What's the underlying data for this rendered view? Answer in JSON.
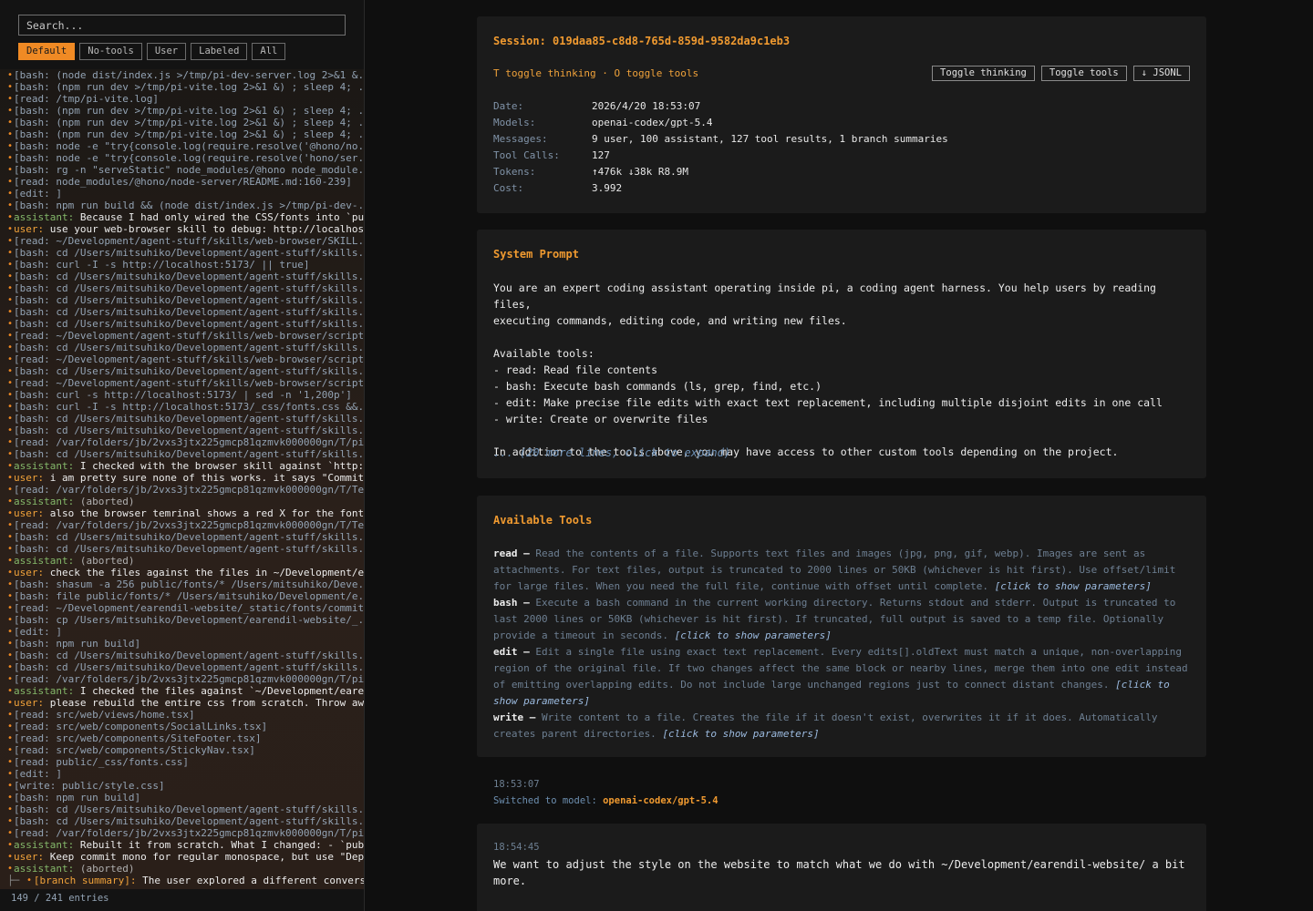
{
  "sidebar": {
    "search_placeholder": "Search...",
    "filters": [
      {
        "label": "Default",
        "active": true
      },
      {
        "label": "No-tools",
        "active": false
      },
      {
        "label": "User",
        "active": false
      },
      {
        "label": "Labeled",
        "active": false
      },
      {
        "label": "All",
        "active": false
      }
    ],
    "entries": [
      {
        "kind": "tool",
        "text": "[bash: (node dist/index.js >/tmp/pi-dev-server.log 2>&1 &."
      },
      {
        "kind": "tool",
        "text": "[bash: (npm run dev >/tmp/pi-vite.log 2>&1 &) ; sleep 4; ."
      },
      {
        "kind": "tool",
        "text": "[read: /tmp/pi-vite.log]"
      },
      {
        "kind": "tool",
        "text": "[bash: (npm run dev >/tmp/pi-vite.log 2>&1 &) ; sleep 4; ."
      },
      {
        "kind": "tool",
        "text": "[bash: (npm run dev >/tmp/pi-vite.log 2>&1 &) ; sleep 4; ."
      },
      {
        "kind": "tool",
        "text": "[bash: (npm run dev >/tmp/pi-vite.log 2>&1 &) ; sleep 4; ."
      },
      {
        "kind": "tool",
        "text": "[bash: node -e \"try{console.log(require.resolve('@hono/no."
      },
      {
        "kind": "tool",
        "text": "[bash: node -e \"try{console.log(require.resolve('hono/ser."
      },
      {
        "kind": "tool",
        "text": "[bash: rg -n \"serveStatic\" node_modules/@hono node_module."
      },
      {
        "kind": "tool",
        "text": "[read: node_modules/@hono/node-server/README.md:160-239]"
      },
      {
        "kind": "tool",
        "text": "[edit: ]"
      },
      {
        "kind": "tool",
        "text": "[bash: npm run build && (node dist/index.js >/tmp/pi-dev-."
      },
      {
        "kind": "asst",
        "role": "assistant:",
        "text": "Because I had only wired the CSS/fonts into `pu"
      },
      {
        "kind": "user",
        "role": "user:",
        "text": "use your web-browser skill to debug: http://localhos"
      },
      {
        "kind": "tool",
        "text": "[read: ~/Development/agent-stuff/skills/web-browser/SKILL."
      },
      {
        "kind": "tool",
        "text": "[bash: cd /Users/mitsuhiko/Development/agent-stuff/skills."
      },
      {
        "kind": "tool",
        "text": "[bash: curl -I -s http://localhost:5173/ || true]"
      },
      {
        "kind": "tool",
        "text": "[bash: cd /Users/mitsuhiko/Development/agent-stuff/skills."
      },
      {
        "kind": "tool",
        "text": "[bash: cd /Users/mitsuhiko/Development/agent-stuff/skills."
      },
      {
        "kind": "tool",
        "text": "[bash: cd /Users/mitsuhiko/Development/agent-stuff/skills."
      },
      {
        "kind": "tool",
        "text": "[bash: cd /Users/mitsuhiko/Development/agent-stuff/skills."
      },
      {
        "kind": "tool",
        "text": "[bash: cd /Users/mitsuhiko/Development/agent-stuff/skills."
      },
      {
        "kind": "tool",
        "text": "[read: ~/Development/agent-stuff/skills/web-browser/script"
      },
      {
        "kind": "tool",
        "text": "[bash: cd /Users/mitsuhiko/Development/agent-stuff/skills."
      },
      {
        "kind": "tool",
        "text": "[read: ~/Development/agent-stuff/skills/web-browser/script"
      },
      {
        "kind": "tool",
        "text": "[bash: cd /Users/mitsuhiko/Development/agent-stuff/skills."
      },
      {
        "kind": "tool",
        "text": "[read: ~/Development/agent-stuff/skills/web-browser/script"
      },
      {
        "kind": "tool",
        "text": "[bash: curl -s http://localhost:5173/ | sed -n '1,200p']"
      },
      {
        "kind": "tool",
        "text": "[bash: curl -I -s http://localhost:5173/_css/fonts.css &&."
      },
      {
        "kind": "tool",
        "text": "[bash: cd /Users/mitsuhiko/Development/agent-stuff/skills."
      },
      {
        "kind": "tool",
        "text": "[bash: cd /Users/mitsuhiko/Development/agent-stuff/skills."
      },
      {
        "kind": "tool",
        "text": "[read: /var/folders/jb/2vxs3jtx225gmcp81qzmvk000000gn/T/pi"
      },
      {
        "kind": "tool",
        "text": "[bash: cd /Users/mitsuhiko/Development/agent-stuff/skills."
      },
      {
        "kind": "asst",
        "role": "assistant:",
        "text": "I checked with the browser skill against `http:"
      },
      {
        "kind": "user",
        "role": "user:",
        "text": "i am pretty sure none of this works. it says \"Commit"
      },
      {
        "kind": "tool",
        "text": "[read: /var/folders/jb/2vxs3jtx225gmcp81qzmvk000000gn/T/Te"
      },
      {
        "kind": "abort",
        "role": "assistant:",
        "text": "(aborted)"
      },
      {
        "kind": "user",
        "role": "user:",
        "text": "also the browser temrinal shows a red X for the font"
      },
      {
        "kind": "tool",
        "text": "[read: /var/folders/jb/2vxs3jtx225gmcp81qzmvk000000gn/T/Te"
      },
      {
        "kind": "tool",
        "text": "[bash: cd /Users/mitsuhiko/Development/agent-stuff/skills."
      },
      {
        "kind": "tool",
        "text": "[bash: cd /Users/mitsuhiko/Development/agent-stuff/skills."
      },
      {
        "kind": "abort",
        "role": "assistant:",
        "text": "(aborted)"
      },
      {
        "kind": "user",
        "role": "user:",
        "text": "check the files against the files in ~/Development/e"
      },
      {
        "kind": "tool",
        "text": "[bash: shasum -a 256 public/fonts/* /Users/mitsuhiko/Deve."
      },
      {
        "kind": "tool",
        "text": "[bash: file public/fonts/* /Users/mitsuhiko/Development/e."
      },
      {
        "kind": "tool",
        "text": "[read: ~/Development/earendil-website/_static/fonts/commit"
      },
      {
        "kind": "tool",
        "text": "[bash: cp /Users/mitsuhiko/Development/earendil-website/_."
      },
      {
        "kind": "tool",
        "text": "[edit: ]"
      },
      {
        "kind": "tool",
        "text": "[bash: npm run build]"
      },
      {
        "kind": "tool",
        "text": "[bash: cd /Users/mitsuhiko/Development/agent-stuff/skills."
      },
      {
        "kind": "tool",
        "text": "[bash: cd /Users/mitsuhiko/Development/agent-stuff/skills."
      },
      {
        "kind": "tool",
        "text": "[read: /var/folders/jb/2vxs3jtx225gmcp81qzmvk000000gn/T/pi"
      },
      {
        "kind": "asst",
        "role": "assistant:",
        "text": "I checked the files against `~/Development/eare"
      },
      {
        "kind": "user",
        "role": "user:",
        "text": "please rebuild the entire css from scratch. Throw aw"
      },
      {
        "kind": "tool",
        "text": "[read: src/web/views/home.tsx]"
      },
      {
        "kind": "tool",
        "text": "[read: src/web/components/SocialLinks.tsx]"
      },
      {
        "kind": "tool",
        "text": "[read: src/web/components/SiteFooter.tsx]"
      },
      {
        "kind": "tool",
        "text": "[read: src/web/components/StickyNav.tsx]"
      },
      {
        "kind": "tool",
        "text": "[read: public/_css/fonts.css]"
      },
      {
        "kind": "tool",
        "text": "[edit: ]"
      },
      {
        "kind": "tool",
        "text": "[write: public/style.css]"
      },
      {
        "kind": "tool",
        "text": "[bash: npm run build]"
      },
      {
        "kind": "tool",
        "text": "[bash: cd /Users/mitsuhiko/Development/agent-stuff/skills."
      },
      {
        "kind": "tool",
        "text": "[bash: cd /Users/mitsuhiko/Development/agent-stuff/skills."
      },
      {
        "kind": "tool",
        "text": "[read: /var/folders/jb/2vxs3jtx225gmcp81qzmvk000000gn/T/pi"
      },
      {
        "kind": "asst",
        "role": "assistant:",
        "text": "Rebuilt it from scratch. What I changed: - `pub"
      },
      {
        "kind": "user",
        "role": "user:",
        "text": "Keep commit mono for regular monospace, but use \"Dep"
      },
      {
        "kind": "abort",
        "role": "assistant:",
        "text": "(aborted)"
      },
      {
        "kind": "branch",
        "role": "[branch summary]:",
        "text": "The user explored a different convers"
      }
    ],
    "count": "149 / 241 entries"
  },
  "header": {
    "session_title": "Session: 019daa85-c8d8-765d-859d-9582da9c1eb3",
    "toggle_hint": "T toggle thinking · O toggle tools",
    "buttons": [
      "Toggle thinking",
      "Toggle tools",
      "↓ JSONL"
    ],
    "meta": [
      {
        "key": "Date:",
        "value": "2026/4/20 18:53:07"
      },
      {
        "key": "Models:",
        "value": "openai-codex/gpt-5.4"
      },
      {
        "key": "Messages:",
        "value": "9 user, 100 assistant, 127 tool results, 1 branch summaries"
      },
      {
        "key": "Tool Calls:",
        "value": "127"
      },
      {
        "key": "Tokens:",
        "value": "↑476k ↓38k R8.9M"
      },
      {
        "key": "Cost:",
        "value": "3.992"
      }
    ]
  },
  "system_prompt": {
    "title": "System Prompt",
    "body": "You are an expert coding assistant operating inside pi, a coding agent harness. You help users by reading files,\nexecuting commands, editing code, and writing new files.\n\nAvailable tools:\n- read: Read file contents\n- bash: Execute bash commands (ls, grep, find, etc.)\n- edit: Make precise file edits with exact text replacement, including multiple disjoint edits in one call\n- write: Create or overwrite files\n\nIn addition to the tools above, you may have access to other custom tools depending on the project.",
    "more": "... (20 more lines, click to expand)"
  },
  "tools": {
    "title": "Available Tools",
    "items": [
      {
        "name": "read",
        "desc": "Read the contents of a file. Supports text files and images (jpg, png, gif, webp). Images are sent as attachments. For text files, output is truncated to 2000 lines or 50KB (whichever is hit first). Use offset/limit for large files. When you need the full file, continue with offset until complete.",
        "expand": "[click to show parameters]"
      },
      {
        "name": "bash",
        "desc": "Execute a bash command in the current working directory. Returns stdout and stderr. Output is truncated to last 2000 lines or 50KB (whichever is hit first). If truncated, full output is saved to a temp file. Optionally provide a timeout in seconds.",
        "expand": "[click to show parameters]"
      },
      {
        "name": "edit",
        "desc": "Edit a single file using exact text replacement. Every edits[].oldText must match a unique, non-overlapping region of the original file. If two changes affect the same block or nearby lines, merge them into one edit instead of emitting overlapping edits. Do not include large unchanged regions just to connect distant changes.",
        "expand": "[click to show parameters]"
      },
      {
        "name": "write",
        "desc": "Write content to a file. Creates the file if it doesn't exist, overwrites it if it does. Automatically creates parent directories.",
        "expand": "[click to show parameters]"
      }
    ]
  },
  "model_switch": {
    "time": "18:53:07",
    "label": "Switched to model: ",
    "model": "openai-codex/gpt-5.4"
  },
  "user_message": {
    "time": "18:54:45",
    "text": "We want to adjust the style on the website to match what we do with ~/Development/earendil-website/ a bit more."
  }
}
